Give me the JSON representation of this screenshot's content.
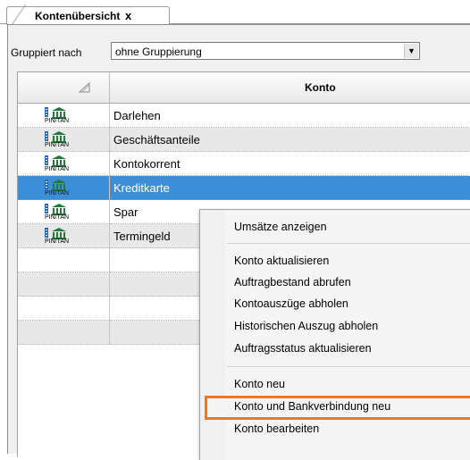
{
  "tab": {
    "title": "Kontenübersicht",
    "close_glyph": "x"
  },
  "grouping": {
    "label": "Gruppiert nach",
    "value": "ohne Gruppierung",
    "arrow_glyph": "▼"
  },
  "grid": {
    "column_header": "Konto",
    "icon_badge_text": "PIN/TAN",
    "rows": [
      {
        "name": "Darlehen"
      },
      {
        "name": "Geschäftsanteile"
      },
      {
        "name": "Kontokorrent"
      },
      {
        "name": "Kreditkarte",
        "selected": true
      },
      {
        "name": "Spar"
      },
      {
        "name": "Termingeld"
      }
    ]
  },
  "context_menu": {
    "items": [
      "Umsätze anzeigen",
      "Konto aktualisieren",
      "Auftragbestand abrufen",
      "Kontoauszüge abholen",
      "Historischen Auszug abholen",
      "Auftragsstatus aktualisieren",
      "Konto neu",
      "Konto und Bankverbindung neu",
      "Konto bearbeiten"
    ],
    "highlighted_item": "Konto bearbeiten"
  },
  "colors": {
    "selection": "#3b8fd8",
    "highlight_border": "#e8792c",
    "bank_icon": "#1f7a3c"
  }
}
